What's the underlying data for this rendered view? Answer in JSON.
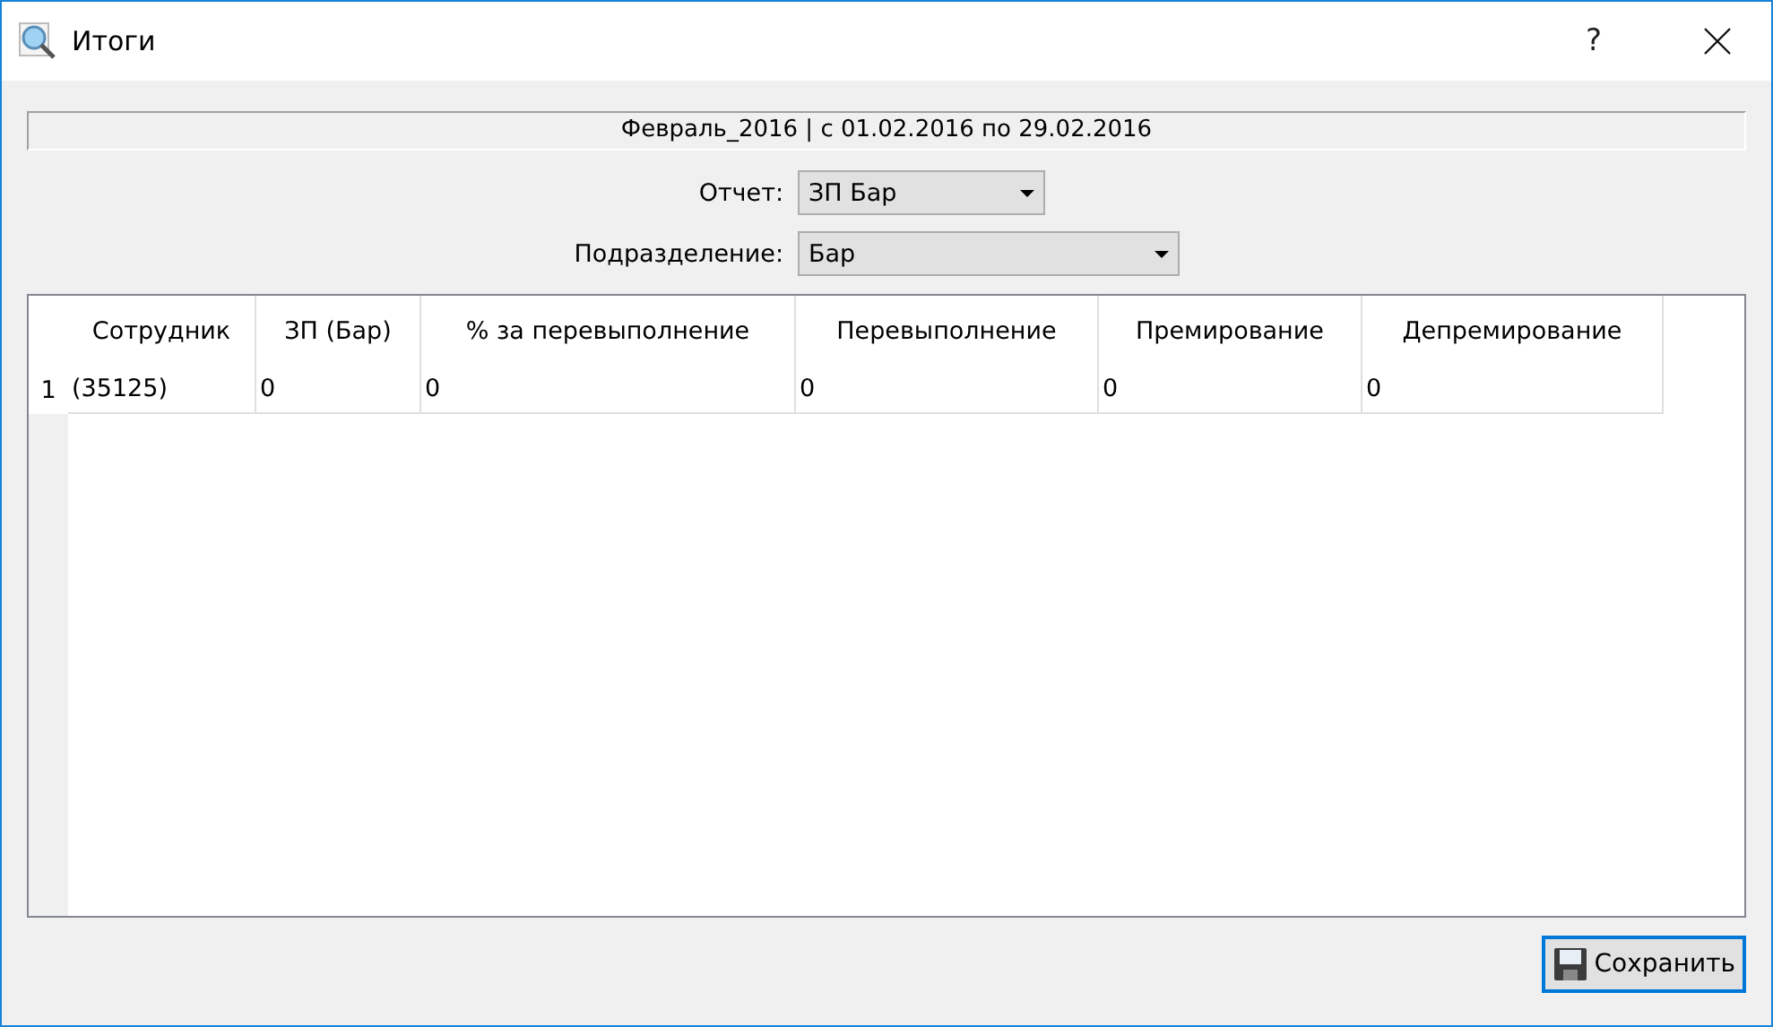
{
  "window": {
    "title": "Итоги",
    "help": "?"
  },
  "period": "Февраль_2016 | с 01.02.2016 по 29.02.2016",
  "filters": [
    {
      "label": "Отчет:",
      "value": "ЗП Бар"
    },
    {
      "label": "Подразделение:",
      "value": "Бар"
    }
  ],
  "table": {
    "columns": [
      "Сотрудник",
      "ЗП (Бар)",
      "% за перевыполнение",
      "Перевыполнение",
      "Премирование",
      "Депремирование"
    ],
    "rows": [
      {
        "number": "1",
        "cells": [
          "(35125)",
          "0",
          "0",
          "0",
          "0",
          "0"
        ]
      }
    ]
  },
  "buttons": [
    {
      "label": "Сохранить"
    }
  ]
}
